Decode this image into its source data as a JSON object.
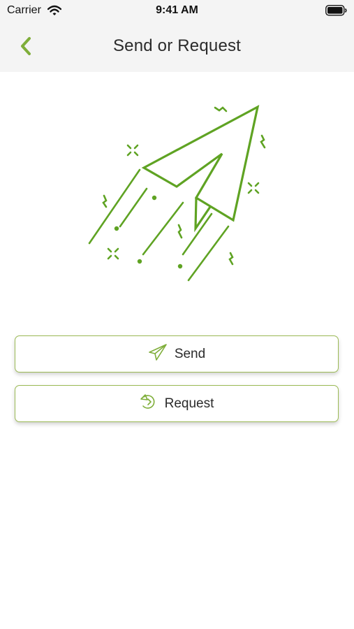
{
  "status_bar": {
    "carrier": "Carrier",
    "time": "9:41 AM"
  },
  "nav": {
    "title": "Send or Request",
    "back_icon": "chevron-left-icon"
  },
  "hero": {
    "icon": "paper-plane-illustration"
  },
  "actions": {
    "send_label": "Send",
    "send_icon": "paper-plane-icon",
    "request_label": "Request",
    "request_icon": "request-arrow-icon"
  },
  "colors": {
    "accent": "#5fa323",
    "button_border": "#9bba55",
    "header_bg": "#f4f4f4"
  }
}
